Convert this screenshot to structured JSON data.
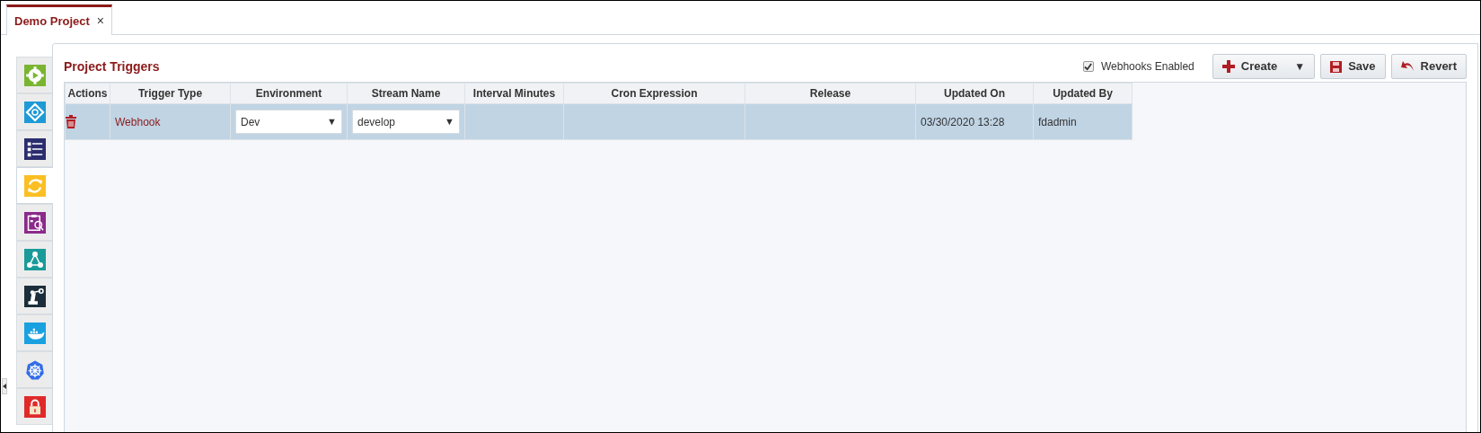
{
  "tabs": [
    {
      "label": "Demo Project",
      "close": "×",
      "selected": true
    }
  ],
  "sidebar": {
    "items": [
      {
        "kind": "play-gear",
        "selected": false
      },
      {
        "kind": "diamond",
        "selected": false
      },
      {
        "kind": "list",
        "selected": false
      },
      {
        "kind": "sync",
        "selected": true
      },
      {
        "kind": "clipboard",
        "selected": false
      },
      {
        "kind": "network",
        "selected": false
      },
      {
        "kind": "robot-arm",
        "selected": false
      },
      {
        "kind": "whale",
        "selected": false
      },
      {
        "kind": "wheel",
        "selected": false
      },
      {
        "kind": "lock",
        "selected": false
      }
    ]
  },
  "panel": {
    "title": "Project Triggers",
    "webhooks_enabled": {
      "label": "Webhooks Enabled",
      "checked": true
    },
    "buttons": [
      {
        "kind": "create",
        "label": "Create",
        "dropdown": "▼"
      },
      {
        "kind": "save",
        "label": "Save"
      },
      {
        "kind": "revert",
        "label": "Revert"
      }
    ]
  },
  "table": {
    "columns": [
      "Actions",
      "Trigger Type",
      "Environment",
      "Stream Name",
      "Interval Minutes",
      "Cron Expression",
      "Release",
      "Updated On",
      "Updated By"
    ],
    "rows": [
      {
        "selected": true,
        "trigger_type": "Webhook",
        "environment": "Dev",
        "stream_name": "develop",
        "interval_minutes": "",
        "updated_on": "03/30/2020 13:28",
        "updated_by": "fdadmin"
      }
    ]
  },
  "dropdown_arrow": "▼"
}
